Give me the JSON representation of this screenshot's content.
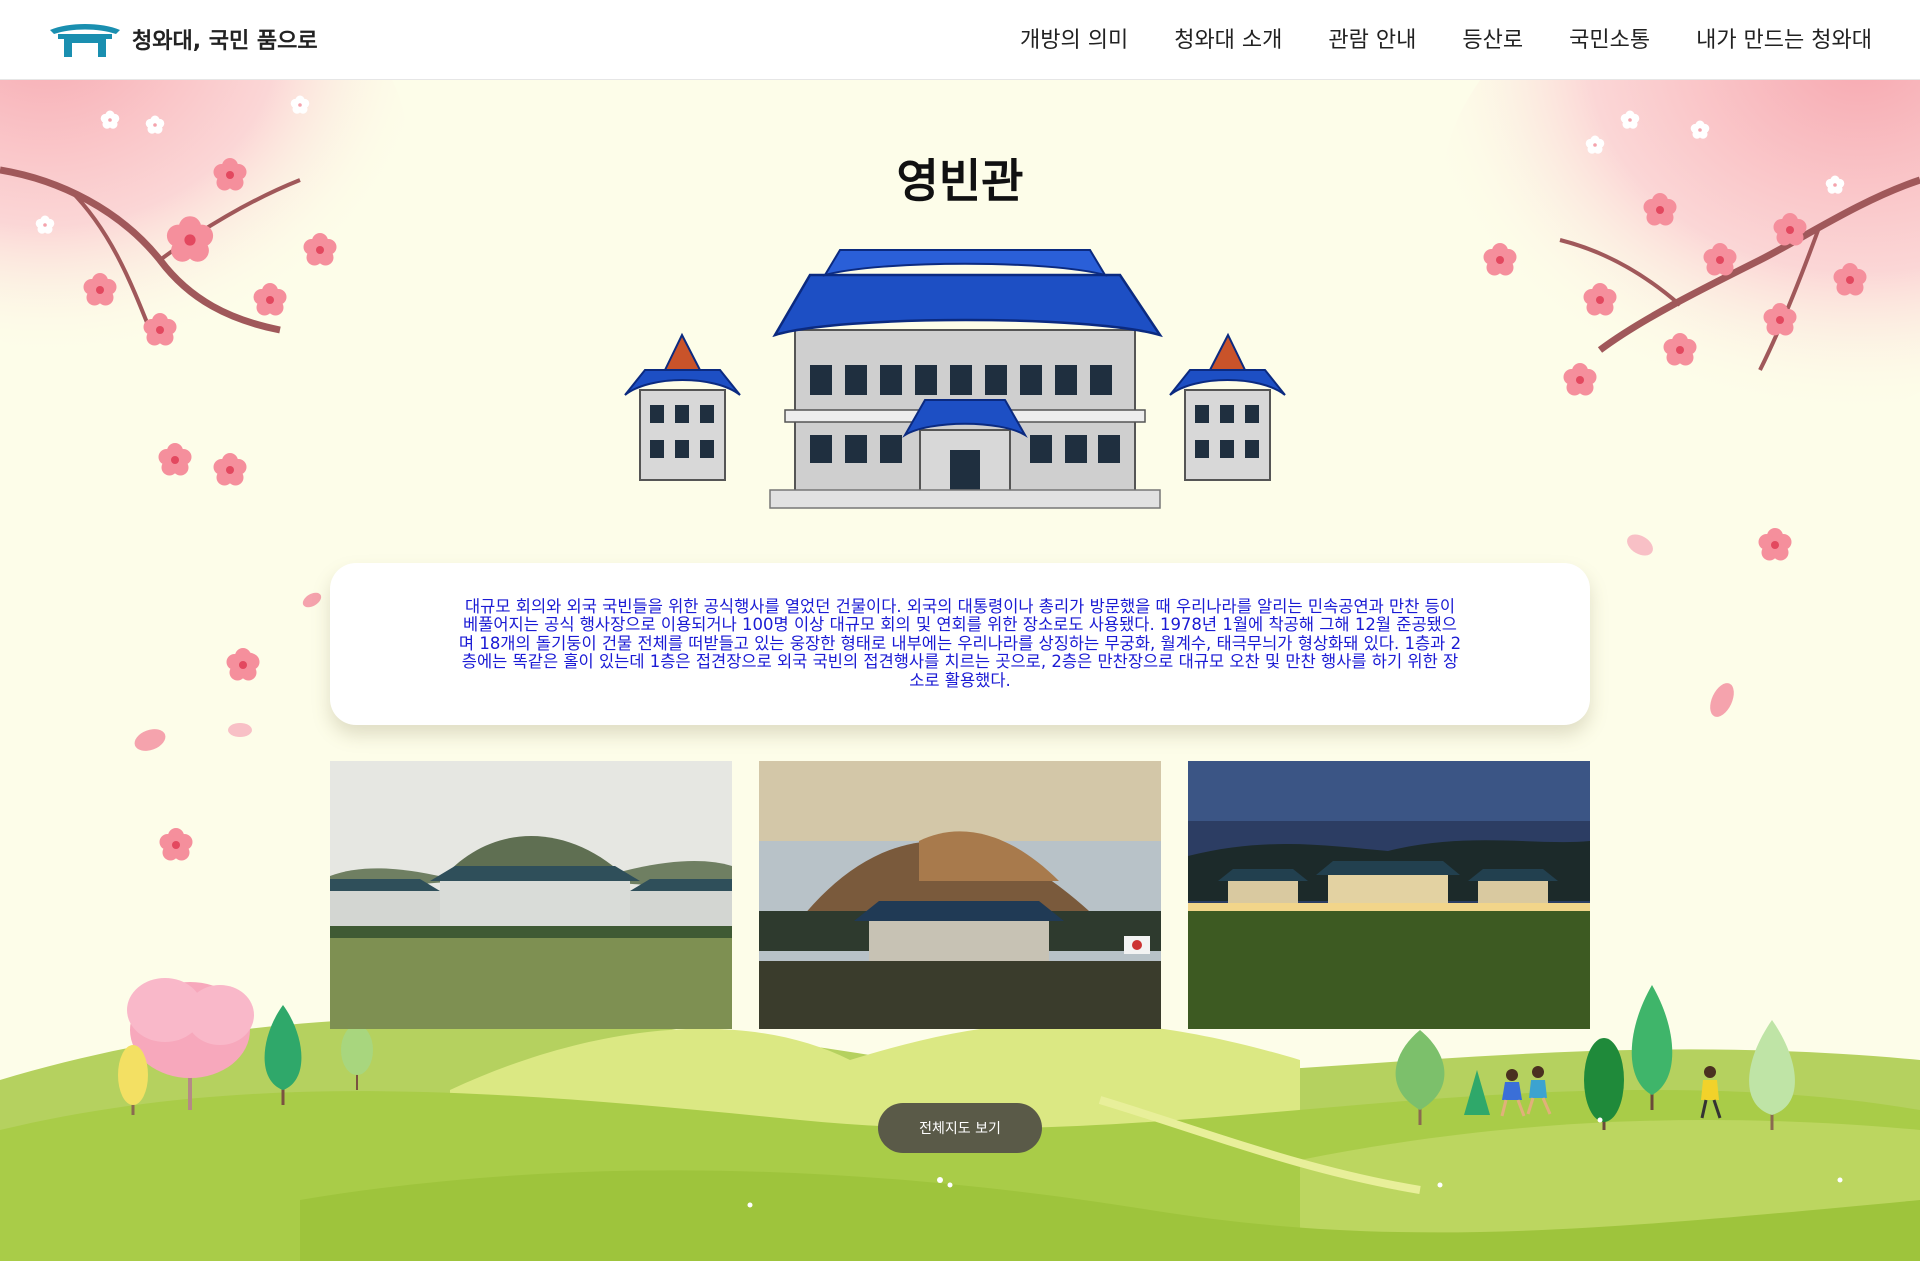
{
  "header": {
    "logo_text": "청와대, 국민 품으로",
    "nav": [
      "개방의 의미",
      "청와대 소개",
      "관람 안내",
      "등산로",
      "국민소통",
      "내가 만드는 청와대"
    ]
  },
  "main": {
    "title": "영빈관",
    "description": "대규모 회의와 외국 국빈들을 위한 공식행사를 열었던 건물이다. 외국의 대통령이나 총리가 방문했을 때 우리나라를 알리는 민속공연과 만찬 등이 베풀어지는 공식 행사장으로 이용되거나 100명 이상 대규모 회의 및 연회를 위한 장소로도 사용됐다. 1978년 1월에 착공해 그해 12월 준공됐으며 18개의 돌기둥이 건물 전체를 떠받들고 있는 웅장한 형태로 내부에는 우리나라를 상징하는 무궁화, 월계수, 태극무늬가 형상화돼 있다. 1층과 2층에는 똑같은 홀이 있는데 1층은 접견장으로 외국 국빈의 접견행사를 치르는 곳으로, 2층은 만찬장으로 대규모 오찬 및 만찬 행사를 하기 위한 장소로 활용했다.",
    "map_button": "전체지도 보기"
  },
  "colors": {
    "accent_text": "#1a1ad4",
    "button_bg": "#5a5a48",
    "roof_blue": "#1d4fc4",
    "page_bg": "#fdfde9"
  }
}
